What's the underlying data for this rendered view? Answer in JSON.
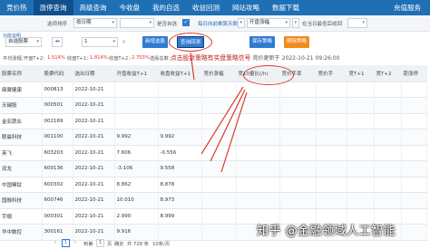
{
  "nav": {
    "tabs": [
      "竞价热",
      "涨停查询",
      "高级查询",
      "今收盘",
      "我的自选",
      "收益回测",
      "网站攻略",
      "数据下载"
    ],
    "active_index": 1,
    "user": "充值服务"
  },
  "filter1": {
    "sort_label": "选项排序",
    "sort_value": "按日期",
    "dropdown2": "",
    "checkbox_label": "是否自选",
    "date_placeholder": "每日向前推算天数",
    "open_label": "开盘涨幅",
    "open_range_start": "开盘涨幅",
    "open_min_label": "在当日最低后收回",
    "open_range_end": "",
    "link_text": "功能说明"
  },
  "filter2": {
    "field1": "自选股票",
    "field2": "+",
    "field3": "1",
    "x_label": "×"
  },
  "buttons": {
    "new": "新增选股",
    "sort": "查询回测",
    "save": "保存策略",
    "delete": "删除策略"
  },
  "summary": {
    "avg": "平均涨幅：",
    "open": "开盘T+2：",
    "open_val": "1.514%",
    "close": "收盘T+1：",
    "close_val": "1.814%",
    "close2": "收盘T+2：",
    "close2_val": "2.703%",
    "count": "选股总数：",
    "count_val": "1"
  },
  "banner": {
    "text": "点击股新策略有实盘策略信号",
    "ts_prefix": "竞价更新于",
    "ts": "2022-10-21 09:26:00"
  },
  "table": {
    "headers": [
      "股票名称",
      "股票代码",
      "选出日期",
      "开盘收益T+1",
      "收盘收益T+1",
      "竞价涨幅",
      "竞10量比(/h)",
      "竞价手率",
      "竞价手",
      "竞T+1",
      "竞T+2",
      "距涨停"
    ],
    "rows": [
      [
        "鼎翼健康",
        "000813",
        "2022-10-21",
        "",
        "",
        "",
        "",
        "",
        "",
        "",
        "",
        ""
      ],
      [
        "天键股",
        "000501",
        "2022-10-21",
        "",
        "",
        "",
        "",
        "",
        "",
        "",
        "",
        ""
      ],
      [
        "金宏蔬业",
        "002169",
        "2022-10-21",
        "",
        "",
        "",
        "",
        "",
        "",
        "",
        "",
        ""
      ],
      [
        "联晨科技",
        "001100",
        "2022-10-21",
        "9.992",
        "9.992",
        "",
        "",
        "",
        "",
        "",
        "",
        ""
      ],
      [
        "英飞",
        "603203",
        "2022-10-21",
        "7.606",
        "-0.556",
        "",
        "",
        "",
        "",
        "",
        "",
        ""
      ],
      [
        "双龙",
        "600136",
        "2022-10-21",
        "-3.106",
        "9.558",
        "",
        "",
        "",
        "",
        "",
        "",
        ""
      ],
      [
        "中国稀钛",
        "600302",
        "2022-10-21",
        "8.862",
        "8.878",
        "",
        "",
        "",
        "",
        "",
        "",
        ""
      ],
      [
        "国融科技",
        "600746",
        "2022-10-21",
        "10.010",
        "8.973",
        "",
        "",
        "",
        "",
        "",
        "",
        ""
      ],
      [
        "宇顺",
        "000301",
        "2022-10-21",
        "2.990",
        "8.999",
        "",
        "",
        "",
        "",
        "",
        "",
        ""
      ],
      [
        "华中数控",
        "300161",
        "2022-10-21",
        "9.916",
        "",
        "",
        "",
        "",
        "",
        "",
        "",
        ""
      ]
    ]
  },
  "pager": {
    "prev": "‹",
    "page": "1",
    "next": "›",
    "goto": "到第",
    "goto_val": "1",
    "unit": "页",
    "confirm": "确定",
    "total": "共 728 条",
    "per_page": "10条/页"
  },
  "watermark": "知乎 @金融领域人工智能"
}
